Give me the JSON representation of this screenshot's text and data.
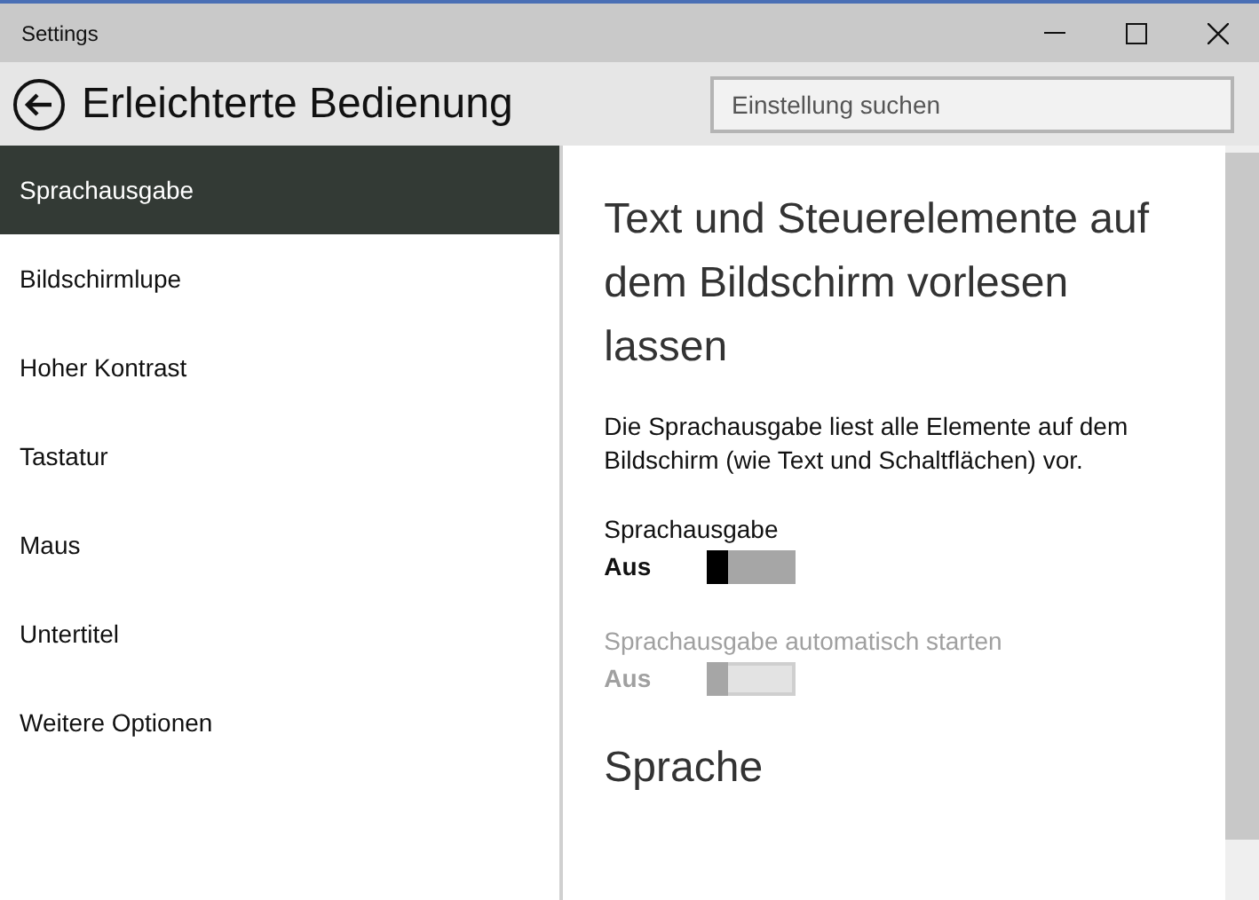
{
  "window": {
    "title": "Settings"
  },
  "header": {
    "title": "Erleichterte Bedienung",
    "search": {
      "placeholder": "Einstellung suchen"
    }
  },
  "sidebar": {
    "items": [
      {
        "label": "Sprachausgabe",
        "selected": true
      },
      {
        "label": "Bildschirmlupe",
        "selected": false
      },
      {
        "label": "Hoher Kontrast",
        "selected": false
      },
      {
        "label": "Tastatur",
        "selected": false
      },
      {
        "label": "Maus",
        "selected": false
      },
      {
        "label": "Untertitel",
        "selected": false
      },
      {
        "label": "Weitere Optionen",
        "selected": false
      }
    ]
  },
  "content": {
    "heading": "Text und Steuerelemente auf dem Bildschirm vorlesen lassen",
    "description": "Die Sprachausgabe liest alle Elemente auf dem Bildschirm (wie Text und Schaltflächen) vor.",
    "toggles": [
      {
        "label": "Sprachausgabe",
        "state_text": "Aus",
        "on": false,
        "disabled": false
      },
      {
        "label": "Sprachausgabe automatisch starten",
        "state_text": "Aus",
        "on": false,
        "disabled": true
      }
    ],
    "section_heading": "Sprache"
  }
}
